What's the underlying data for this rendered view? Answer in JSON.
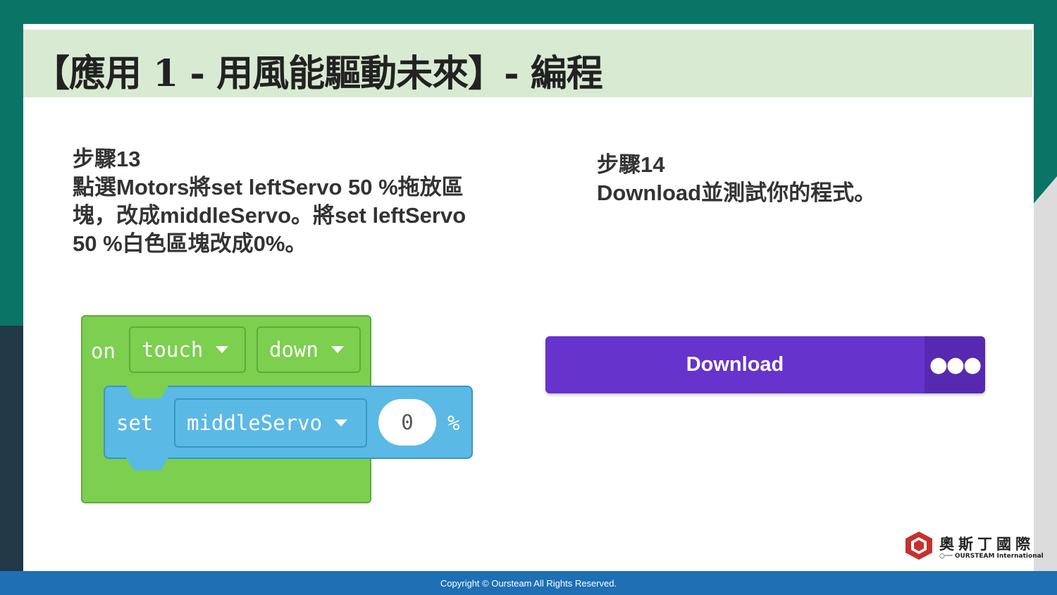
{
  "slide": {
    "title": "【應用 1 - 用風能驅動未來】- 編程"
  },
  "step13": {
    "lines": [
      "步驟13",
      "點選Motors將set leftServo 50 %拖放區",
      "塊，改成middleServo。將set leftServo",
      "50 %白色區塊改成0%。"
    ]
  },
  "step14": {
    "lines": [
      "步驟14",
      "Download並測試你的程式。"
    ]
  },
  "block": {
    "on": "on",
    "event": "touch",
    "state": "down",
    "set": "set",
    "servo": "middleServo",
    "value": "0",
    "unit": "%"
  },
  "download": {
    "label": "Download",
    "more": "●●●",
    "color": "#6633cc"
  },
  "logo": {
    "cn": "奧斯丁國際",
    "en": "○── OURSTEAM International"
  },
  "footer": {
    "copyright": "Copyright © Oursteam All Rights Reserved."
  }
}
